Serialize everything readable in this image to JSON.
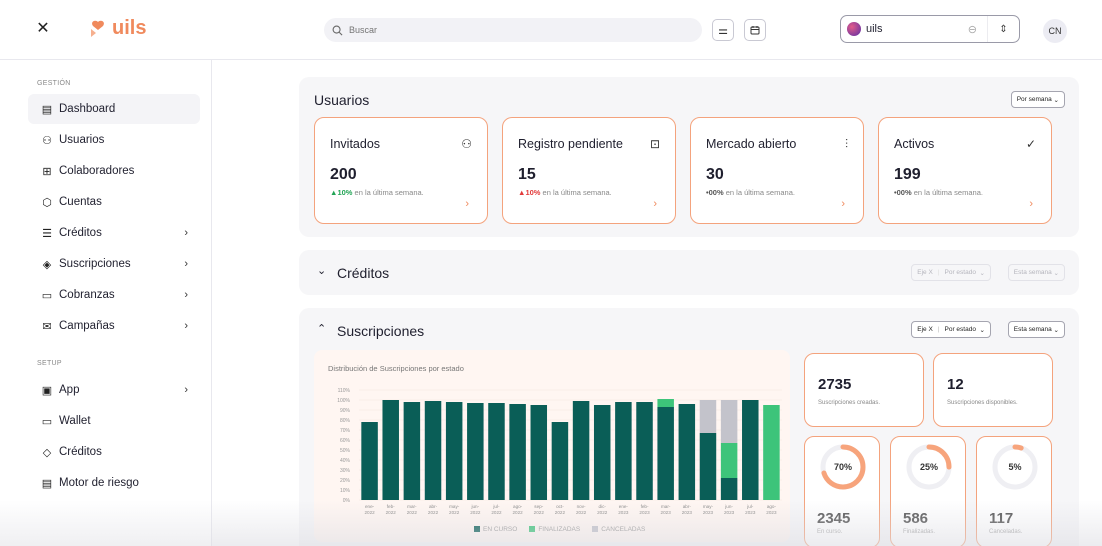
{
  "header": {
    "logo_text": "uils",
    "search_placeholder": "Buscar",
    "org_name": "uils",
    "user_initials": "CN"
  },
  "sidebar": {
    "section_gestion": "GESTIÓN",
    "section_setup": "SETUP",
    "items": [
      {
        "label": "Dashboard",
        "icon": "dashboard-icon",
        "chevron": false
      },
      {
        "label": "Usuarios",
        "icon": "users-icon",
        "chevron": false
      },
      {
        "label": "Colaboradores",
        "icon": "briefcase-icon",
        "chevron": false
      },
      {
        "label": "Cuentas",
        "icon": "cube-icon",
        "chevron": false
      },
      {
        "label": "Créditos",
        "icon": "list-icon",
        "chevron": true
      },
      {
        "label": "Suscripciones",
        "icon": "layers-icon",
        "chevron": true
      },
      {
        "label": "Cobranzas",
        "icon": "folder-icon",
        "chevron": true
      },
      {
        "label": "Campañas",
        "icon": "mail-icon",
        "chevron": true
      }
    ],
    "setup_items": [
      {
        "label": "App",
        "icon": "image-icon",
        "chevron": true
      },
      {
        "label": "Wallet",
        "icon": "wallet-icon",
        "chevron": false
      },
      {
        "label": "Créditos",
        "icon": "tag-icon",
        "chevron": false
      },
      {
        "label": "Motor de riesgo",
        "icon": "document-icon",
        "chevron": false
      }
    ]
  },
  "usuarios": {
    "title": "Usuarios",
    "period": "Por semana",
    "cards": [
      {
        "title": "Invitados",
        "value": "200",
        "delta": "10%",
        "delta_sign": "▲",
        "delta_color": "#22a455",
        "delta_text": "en la última semana."
      },
      {
        "title": "Registro pendiente",
        "value": "15",
        "delta": "10%",
        "delta_sign": "▲",
        "delta_color": "#e23b3b",
        "delta_text": "en la última semana."
      },
      {
        "title": "Mercado abierto",
        "value": "30",
        "delta": "00%",
        "delta_sign": "•",
        "delta_color": "#555555",
        "delta_text": "en la última semana."
      },
      {
        "title": "Activos",
        "value": "199",
        "delta": "00%",
        "delta_sign": "•",
        "delta_color": "#555555",
        "delta_text": "en la última semana."
      }
    ]
  },
  "creditos": {
    "title": "Créditos",
    "axis_label": "Eje X",
    "axis_value": "Por estado",
    "period": "Esta semana"
  },
  "suscripciones": {
    "title": "Suscripciones",
    "axis_label": "Eje X",
    "axis_value": "Por estado",
    "period": "Esta semana",
    "created_value": "2735",
    "created_label": "Suscripciones creadas.",
    "available_value": "12",
    "available_label": "Suscripciones disponibles.",
    "rings": [
      {
        "percent": 70,
        "label": "70%",
        "value": "2345",
        "caption": "En curso."
      },
      {
        "percent": 25,
        "label": "25%",
        "value": "586",
        "caption": "Finalizadas."
      },
      {
        "percent": 5,
        "label": "5%",
        "value": "117",
        "caption": "Canceladas."
      }
    ]
  },
  "chart_data": {
    "type": "bar",
    "stacked": true,
    "title": "Distribución de Suscripciones por estado",
    "categories": [
      [
        "ene-",
        "2022"
      ],
      [
        "feb-",
        "2022"
      ],
      [
        "mar-",
        "2022"
      ],
      [
        "abr-",
        "2022"
      ],
      [
        "may-",
        "2022"
      ],
      [
        "jun-",
        "2022"
      ],
      [
        "jul-",
        "2022"
      ],
      [
        "ago-",
        "2022"
      ],
      [
        "sep-",
        "2022"
      ],
      [
        "oct-",
        "2022"
      ],
      [
        "nov-",
        "2022"
      ],
      [
        "dic-",
        "2022"
      ],
      [
        "ene-",
        "2023"
      ],
      [
        "feb-",
        "2023"
      ],
      [
        "mar-",
        "2023"
      ],
      [
        "abr-",
        "2023"
      ],
      [
        "may-",
        "2023"
      ],
      [
        "jun-",
        "2023"
      ],
      [
        "jul-",
        "2023"
      ],
      [
        "ago-",
        "2023"
      ]
    ],
    "series": [
      {
        "name": "EN CURSO",
        "color": "#0a5e57",
        "values": [
          78,
          100,
          98,
          99,
          98,
          97,
          97,
          96,
          95,
          78,
          99,
          95,
          98,
          98,
          93,
          96,
          67,
          22,
          100,
          0
        ]
      },
      {
        "name": "FINALIZADAS",
        "color": "#3dc47a",
        "values": [
          0,
          0,
          0,
          0,
          0,
          0,
          0,
          0,
          0,
          0,
          0,
          0,
          0,
          0,
          8,
          0,
          0,
          35,
          0,
          95
        ]
      },
      {
        "name": "CANCELADAS",
        "color": "#c3c3cb",
        "values": [
          0,
          0,
          0,
          0,
          0,
          0,
          0,
          0,
          0,
          0,
          0,
          0,
          0,
          0,
          0,
          0,
          33,
          43,
          0,
          0
        ]
      }
    ],
    "y_ticks": [
      "0%",
      "10%",
      "20%",
      "30%",
      "40%",
      "50%",
      "60%",
      "70%",
      "80%",
      "90%",
      "100%",
      "110%"
    ],
    "ylim": [
      0,
      110
    ]
  },
  "colors": {
    "accent": "#f08a5d",
    "card_border": "#f4a37d"
  }
}
